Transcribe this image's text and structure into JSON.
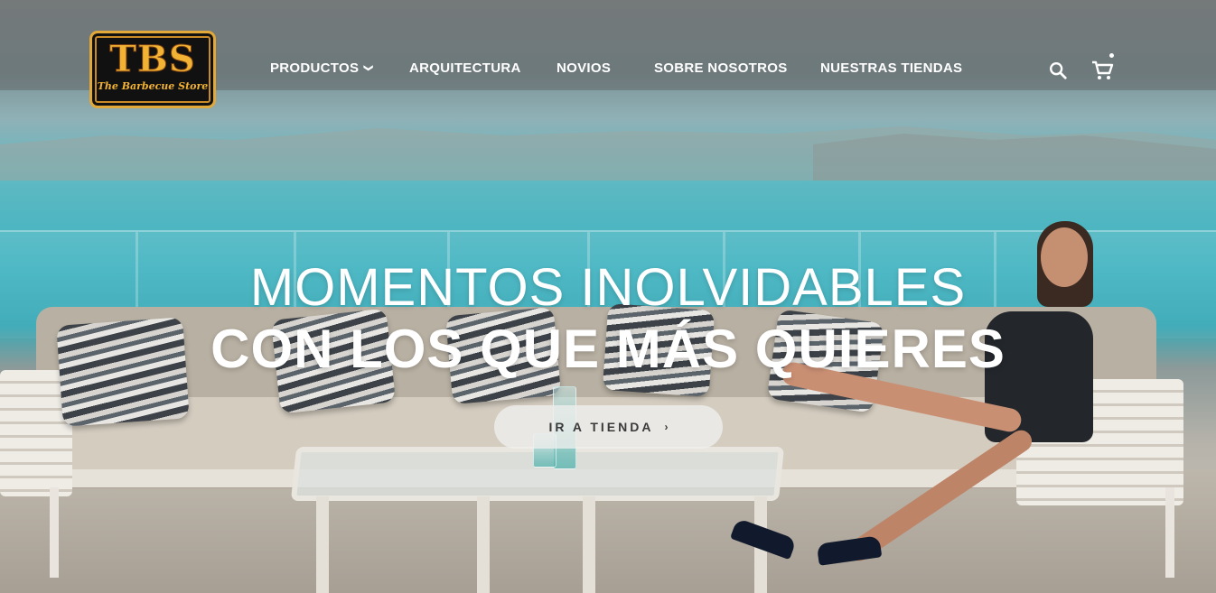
{
  "brand": {
    "logo_text": "TBS",
    "logo_subtitle": "The Barbecue Store",
    "colors": {
      "logo_gold": "#f2b233",
      "logo_bg": "#111111"
    }
  },
  "nav": {
    "items": [
      {
        "label": "PRODUCTOS",
        "has_dropdown": true
      },
      {
        "label": "ARQUITECTURA",
        "has_dropdown": false
      },
      {
        "label": "NOVIOS",
        "has_dropdown": false
      },
      {
        "label": "SOBRE NOSOTROS",
        "has_dropdown": false
      },
      {
        "label": "NUESTRAS TIENDAS",
        "has_dropdown": false
      }
    ],
    "dropdown_icon": "chevron-down-icon"
  },
  "header_icons": {
    "search": "search-icon",
    "cart": "cart-icon"
  },
  "hero": {
    "line1": "MOMENTOS INOLVIDABLES",
    "line2": "CON LOS QUE MÁS QUIERES",
    "cta_label": "IR A TIENDA",
    "cta_icon": "chevron-right-icon"
  }
}
